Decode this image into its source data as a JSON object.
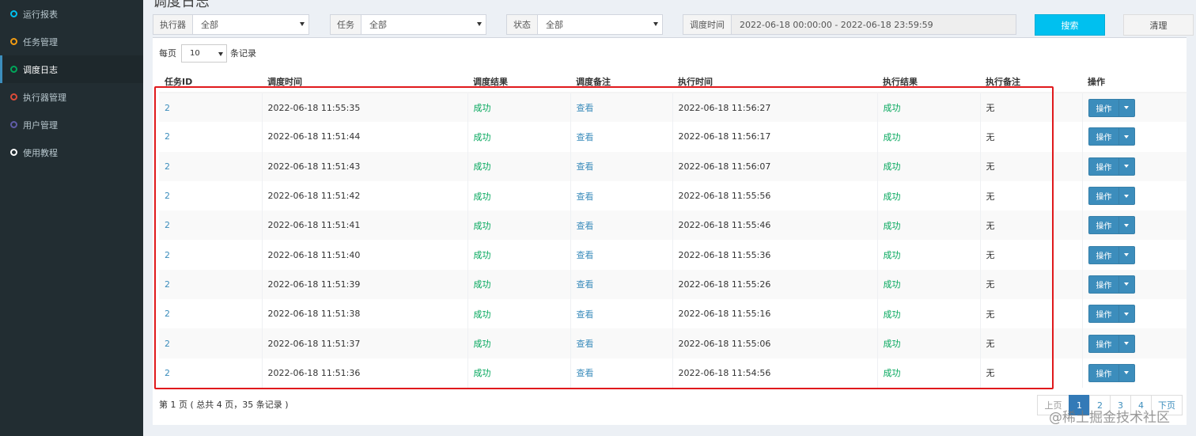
{
  "sidebar": {
    "items": [
      {
        "label": "运行报表",
        "color": "#00c0ef",
        "active": false
      },
      {
        "label": "任务管理",
        "color": "#f39c12",
        "active": false
      },
      {
        "label": "调度日志",
        "color": "#00a65a",
        "active": true
      },
      {
        "label": "执行器管理",
        "color": "#dd4b39",
        "active": false
      },
      {
        "label": "用户管理",
        "color": "#605ca8",
        "active": false
      },
      {
        "label": "使用教程",
        "color": "#ffffff",
        "active": false
      }
    ]
  },
  "page": {
    "title": "调度日志"
  },
  "filters": {
    "executor": {
      "label": "执行器",
      "value": "全部"
    },
    "job": {
      "label": "任务",
      "value": "全部"
    },
    "status": {
      "label": "状态",
      "value": "全部"
    },
    "time": {
      "label": "调度时间",
      "value": "2022-06-18 00:00:00 - 2022-06-18 23:59:59"
    },
    "search_label": "搜索",
    "clear_label": "清理"
  },
  "perpage": {
    "prefix": "每页",
    "value": "10",
    "suffix": "条记录"
  },
  "table": {
    "headers": [
      "任务ID",
      "调度时间",
      "调度结果",
      "调度备注",
      "执行时间",
      "执行结果",
      "执行备注",
      "操作"
    ],
    "rows": [
      {
        "id": "2",
        "trigger_time": "2022-06-18 11:55:35",
        "trigger_result": "成功",
        "trigger_note": "查看",
        "handle_time": "2022-06-18 11:56:27",
        "handle_result": "成功",
        "handle_note": "无",
        "op": "操作"
      },
      {
        "id": "2",
        "trigger_time": "2022-06-18 11:51:44",
        "trigger_result": "成功",
        "trigger_note": "查看",
        "handle_time": "2022-06-18 11:56:17",
        "handle_result": "成功",
        "handle_note": "无",
        "op": "操作"
      },
      {
        "id": "2",
        "trigger_time": "2022-06-18 11:51:43",
        "trigger_result": "成功",
        "trigger_note": "查看",
        "handle_time": "2022-06-18 11:56:07",
        "handle_result": "成功",
        "handle_note": "无",
        "op": "操作"
      },
      {
        "id": "2",
        "trigger_time": "2022-06-18 11:51:42",
        "trigger_result": "成功",
        "trigger_note": "查看",
        "handle_time": "2022-06-18 11:55:56",
        "handle_result": "成功",
        "handle_note": "无",
        "op": "操作"
      },
      {
        "id": "2",
        "trigger_time": "2022-06-18 11:51:41",
        "trigger_result": "成功",
        "trigger_note": "查看",
        "handle_time": "2022-06-18 11:55:46",
        "handle_result": "成功",
        "handle_note": "无",
        "op": "操作"
      },
      {
        "id": "2",
        "trigger_time": "2022-06-18 11:51:40",
        "trigger_result": "成功",
        "trigger_note": "查看",
        "handle_time": "2022-06-18 11:55:36",
        "handle_result": "成功",
        "handle_note": "无",
        "op": "操作"
      },
      {
        "id": "2",
        "trigger_time": "2022-06-18 11:51:39",
        "trigger_result": "成功",
        "trigger_note": "查看",
        "handle_time": "2022-06-18 11:55:26",
        "handle_result": "成功",
        "handle_note": "无",
        "op": "操作"
      },
      {
        "id": "2",
        "trigger_time": "2022-06-18 11:51:38",
        "trigger_result": "成功",
        "trigger_note": "查看",
        "handle_time": "2022-06-18 11:55:16",
        "handle_result": "成功",
        "handle_note": "无",
        "op": "操作"
      },
      {
        "id": "2",
        "trigger_time": "2022-06-18 11:51:37",
        "trigger_result": "成功",
        "trigger_note": "查看",
        "handle_time": "2022-06-18 11:55:06",
        "handle_result": "成功",
        "handle_note": "无",
        "op": "操作"
      },
      {
        "id": "2",
        "trigger_time": "2022-06-18 11:51:36",
        "trigger_result": "成功",
        "trigger_note": "查看",
        "handle_time": "2022-06-18 11:54:56",
        "handle_result": "成功",
        "handle_note": "无",
        "op": "操作"
      }
    ]
  },
  "summary": "第 1 页 ( 总共 4 页，35 条记录 )",
  "pagination": {
    "prev": "上页",
    "pages": [
      "1",
      "2",
      "3",
      "4"
    ],
    "current": "1",
    "next": "下页"
  },
  "watermark": "@稀土掘金技术社区"
}
